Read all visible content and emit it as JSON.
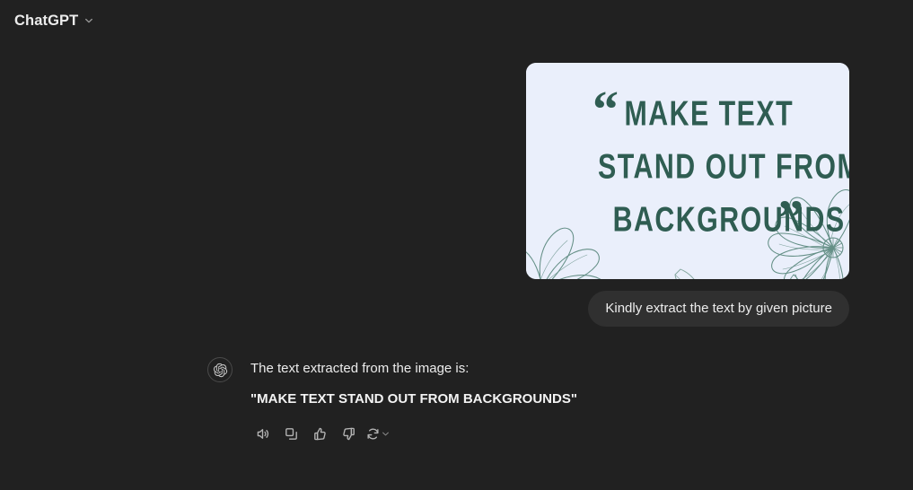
{
  "header": {
    "model_name": "ChatGPT",
    "chevron_icon": "chevron-down-icon"
  },
  "conversation": {
    "user": {
      "attachment": {
        "type": "image",
        "alt": "Quote graphic with floral line art",
        "background_color": "#eaeffb",
        "text_color": "#2f5d52",
        "open_quote": "“",
        "close_quote": "”",
        "lines": [
          "MAKE TEXT",
          "STAND OUT FROM",
          "BACKGROUNDS"
        ],
        "decorations": [
          "flower-left",
          "flower-right",
          "leaf-bottom-center",
          "leaf-bottom-right"
        ]
      },
      "message": "Kindly extract the text by given picture"
    },
    "assistant": {
      "avatar_icon": "openai-logo-icon",
      "intro": "The text extracted from the image is:",
      "result": "\"MAKE TEXT STAND OUT FROM BACKGROUNDS\"",
      "actions": [
        {
          "name": "read-aloud-button",
          "icon": "speaker-icon"
        },
        {
          "name": "copy-button",
          "icon": "copy-icon"
        },
        {
          "name": "thumbs-up-button",
          "icon": "thumbs-up-icon"
        },
        {
          "name": "thumbs-down-button",
          "icon": "thumbs-down-icon"
        },
        {
          "name": "regenerate-button",
          "icon": "regenerate-icon"
        },
        {
          "name": "regenerate-menu-chevron",
          "icon": "chevron-down-icon"
        }
      ]
    }
  },
  "colors": {
    "page_background": "#212121",
    "bubble_background": "#303030",
    "text_primary": "#ececec",
    "icon_muted": "#b4b4b4"
  }
}
